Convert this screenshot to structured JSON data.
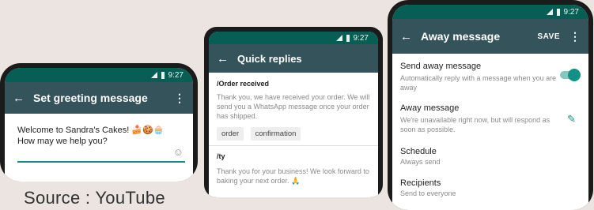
{
  "status_time": "9:27",
  "greeting": {
    "title": "Set greeting message",
    "message_line1": "Welcome to Sandra's Cakes! 🍰🍪🧁",
    "message_line2": "How may we help you?"
  },
  "quick_replies": {
    "title": "Quick replies",
    "items": [
      {
        "shortcut": "/Order received",
        "message": "Thank you, we have received your order. We will send you a WhatsApp message once your order has shipped.",
        "keywords": [
          "order",
          "confirmation"
        ]
      },
      {
        "shortcut": "/ty",
        "message": "Thank you for your business! We look forward to baking your next order. 🙏"
      }
    ]
  },
  "away": {
    "title": "Away message",
    "save_label": "SAVE",
    "send_label": "Send away message",
    "send_sub": "Automatically reply with a message when you are away",
    "toggle_on": true,
    "message_label": "Away message",
    "message_text": "We're unavailable right now, but will respond as soon as possible.",
    "schedule_label": "Schedule",
    "schedule_value": "Always send",
    "recipients_label": "Recipients",
    "recipients_value": "Send to everyone"
  },
  "source_caption": "Source : YouTube",
  "colors": {
    "appbar": "#34535b",
    "status_bar": "#075e54",
    "accent": "#128c7e"
  }
}
